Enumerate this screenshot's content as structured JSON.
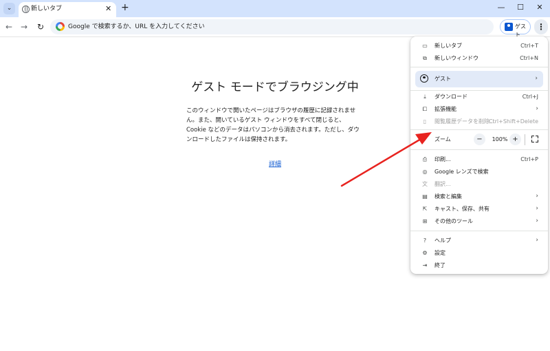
{
  "tab": {
    "title": "新しいタブ",
    "close": "✕"
  },
  "tabstrip": {
    "search_icon": "⌄",
    "new_tab": "+",
    "minimize": "—",
    "maximize": "☐",
    "close": "✕"
  },
  "toolbar": {
    "back": "←",
    "forward": "→",
    "reload": "↻",
    "omnibox_text": "Google で検索するか、URL を入力してください",
    "guest_label": "ゲスト",
    "menu_icon": "⋮"
  },
  "page": {
    "title": "ゲスト モードでブラウジング中",
    "body": "このウィンドウで開いたページはブラウザの履歴に記録されません。また、開いているゲスト ウィンドウをすべて閉じると、Cookie などのデータはパソコンから消去されます。ただし、ダウンロードしたファイルは保持されます。",
    "link": "詳細"
  },
  "menu": {
    "new_tab": {
      "label": "新しいタブ",
      "shortcut": "Ctrl+T",
      "icon": "new-tab-icon"
    },
    "new_window": {
      "label": "新しいウィンドウ",
      "shortcut": "Ctrl+N",
      "icon": "new-window-icon"
    },
    "guest": {
      "label": "ゲスト",
      "arrow": "›"
    },
    "download": {
      "label": "ダウンロード",
      "shortcut": "Ctrl+J"
    },
    "extensions": {
      "label": "拡張機能",
      "arrow": "›"
    },
    "clear_data": {
      "label": "閲覧履歴データを削除...",
      "shortcut": "Ctrl+Shift+Delete",
      "disabled": true
    },
    "zoom": {
      "label": "ズーム",
      "minus": "−",
      "value": "100%",
      "plus": "+"
    },
    "print": {
      "label": "印刷...",
      "shortcut": "Ctrl+P"
    },
    "lens": {
      "label": "Google レンズで検索"
    },
    "translate": {
      "label": "翻訳...",
      "disabled": true
    },
    "find_edit": {
      "label": "検索と編集",
      "arrow": "›"
    },
    "cast_save_share": {
      "label": "キャスト、保存、共有",
      "arrow": "›"
    },
    "more_tools": {
      "label": "その他のツール",
      "arrow": "›"
    },
    "help": {
      "label": "ヘルプ",
      "arrow": "›"
    },
    "settings": {
      "label": "設定"
    },
    "exit": {
      "label": "終了"
    }
  },
  "colors": {
    "tabstrip_bg": "#d3e3fd",
    "accent": "#0b57d0",
    "annotation_arrow": "#e8231f",
    "menu_highlight": "#e2eaf8"
  }
}
